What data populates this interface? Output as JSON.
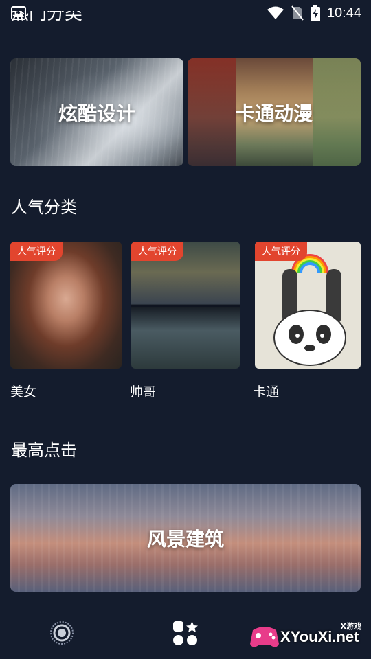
{
  "status_bar": {
    "time": "10:44",
    "left_icon": "image-icon",
    "right_icons": [
      "wifi-icon",
      "no-sim-icon",
      "battery-charging-icon"
    ]
  },
  "sections": {
    "top_partial_title": "热门分类",
    "popular_title": "人气分类",
    "most_clicked_title": "最高点击"
  },
  "featured_cards": [
    {
      "label": "炫酷设计"
    },
    {
      "label": "卡通动漫"
    }
  ],
  "popular_tiles": [
    {
      "badge": "人气评分",
      "caption": "美女"
    },
    {
      "badge": "人气评分",
      "caption": "帅哥"
    },
    {
      "badge": "人气评分",
      "caption": "卡通"
    }
  ],
  "banner": {
    "label": "风景建筑"
  },
  "bottom_nav": {
    "items": [
      "wallpaper-icon",
      "categories-icon"
    ]
  },
  "watermark": {
    "text": "XYouXi.net",
    "small": "X游戏"
  },
  "colors": {
    "background": "#141c2d",
    "badge": "#e2452e"
  }
}
